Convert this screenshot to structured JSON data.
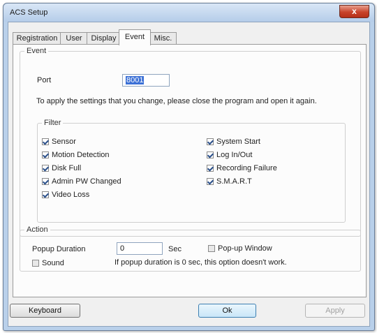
{
  "window": {
    "title": "ACS Setup",
    "close_symbol": "x"
  },
  "tabs": [
    {
      "label": "Registration"
    },
    {
      "label": "User"
    },
    {
      "label": "Display"
    },
    {
      "label": "Event",
      "active": true
    },
    {
      "label": "Misc."
    }
  ],
  "event": {
    "legend": "Event",
    "port_label": "Port",
    "port_value": "8001",
    "note": "To apply the settings that you change, please close the program and open it again."
  },
  "filter": {
    "legend": "Filter",
    "left": [
      {
        "label": "Sensor",
        "checked": true
      },
      {
        "label": "Motion Detection",
        "checked": true
      },
      {
        "label": "Disk Full",
        "checked": true
      },
      {
        "label": "Admin PW Changed",
        "checked": true
      },
      {
        "label": "Video Loss",
        "checked": true
      }
    ],
    "right": [
      {
        "label": "System Start",
        "checked": true
      },
      {
        "label": "Log In/Out",
        "checked": true
      },
      {
        "label": "Recording Failure",
        "checked": true
      },
      {
        "label": "S.M.A.R.T",
        "checked": true
      }
    ]
  },
  "action": {
    "legend": "Action",
    "popup_duration_label": "Popup Duration",
    "popup_duration_value": "0",
    "sec_label": "Sec",
    "popup_window_label": "Pop-up Window",
    "popup_window_checked": false,
    "sound_label": "Sound",
    "sound_checked": false,
    "note": "If popup duration is 0 sec, this option doesn't work."
  },
  "buttons": {
    "keyboard": "Keyboard",
    "ok": "Ok",
    "apply": "Apply"
  }
}
